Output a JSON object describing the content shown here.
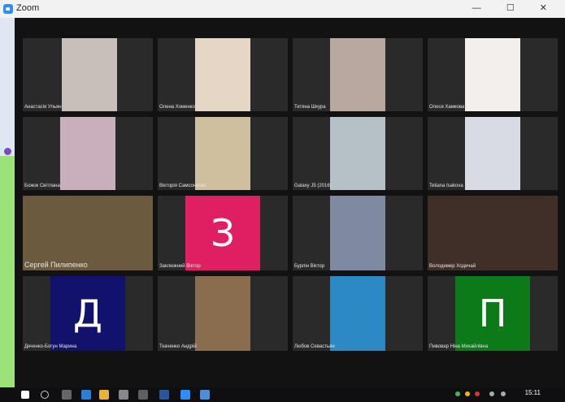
{
  "window": {
    "title": "Zoom"
  },
  "participants": [
    {
      "name": "Анастасія Ульян",
      "bg": "#c8c0b8"
    },
    {
      "name": "Олена Хоменко",
      "bg": "#e6d6c6"
    },
    {
      "name": "Тетяна Шкура",
      "bg": "#b9a8a0"
    },
    {
      "name": "Олеся Хамкова",
      "bg": "#f2efec"
    },
    {
      "name": "Божок Світлана",
      "bg": "#c9aebb"
    },
    {
      "name": "Вікторія Самсоненко",
      "bg": "#cfbf9f"
    },
    {
      "name": "Galaxy J5 (2016)",
      "bg": "#b6c0c7"
    },
    {
      "name": "Tetiana Isakova",
      "bg": "#d8dbe2"
    },
    {
      "name": "Сергей Пилипенко",
      "bg": "#6b5a3e"
    },
    {
      "name": "Заклюжний Віктор",
      "initial": "З",
      "color": "#e01f63"
    },
    {
      "name": "Бурлін Віктор",
      "bg": "#7f8aa0"
    },
    {
      "name": "Володимер Ходичай",
      "bg": "#3f2f28"
    },
    {
      "name": "Деченко-Богун Марина",
      "initial": "Д",
      "color": "#12116b"
    },
    {
      "name": "Ткаченко Андрій",
      "bg": "#8a6c4e"
    },
    {
      "name": "Любов Севастьян",
      "bg": "#2d89c4"
    },
    {
      "name": "Пивовар Ніна Михайлівна",
      "initial": "П",
      "color": "#0d7a1a"
    }
  ],
  "taskbar": {
    "time": "15:11"
  }
}
